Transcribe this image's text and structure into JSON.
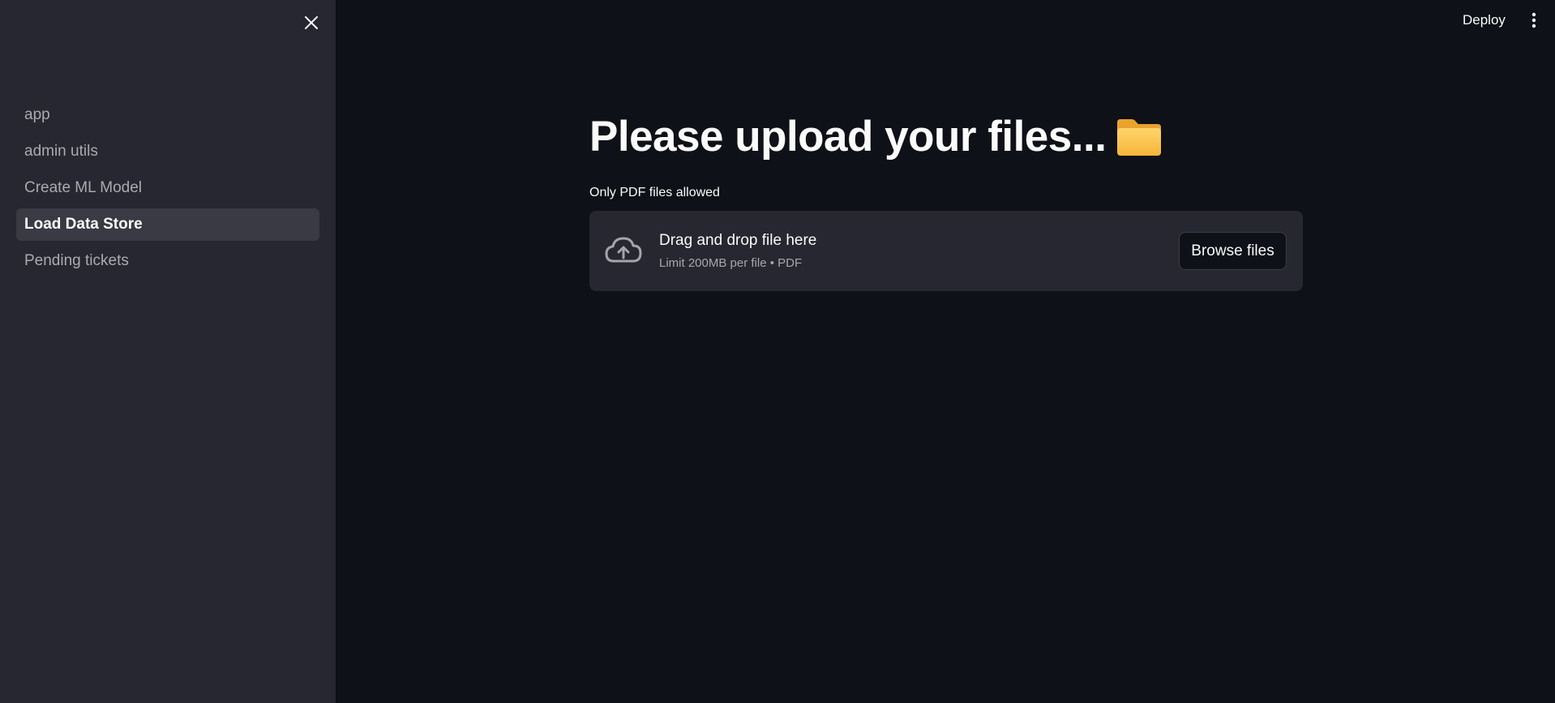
{
  "sidebar": {
    "close_icon": "close-icon",
    "items": [
      {
        "label": "app",
        "active": false
      },
      {
        "label": "admin utils",
        "active": false
      },
      {
        "label": "Create ML Model",
        "active": false
      },
      {
        "label": "Load Data Store",
        "active": true
      },
      {
        "label": "Pending tickets",
        "active": false
      }
    ]
  },
  "header": {
    "deploy_label": "Deploy",
    "menu_icon": "more-vertical-icon"
  },
  "main": {
    "title": "Please upload your files...",
    "title_icon": "folder-icon",
    "uploader": {
      "label": "Only PDF files allowed",
      "drop_text": "Drag and drop file here",
      "limit_text": "Limit 200MB per file • PDF",
      "browse_label": "Browse files",
      "icon": "cloud-upload-icon"
    }
  },
  "colors": {
    "background": "#0e1117",
    "sidebar": "#262730",
    "active_item": "#393a44",
    "text": "#fafafa"
  }
}
